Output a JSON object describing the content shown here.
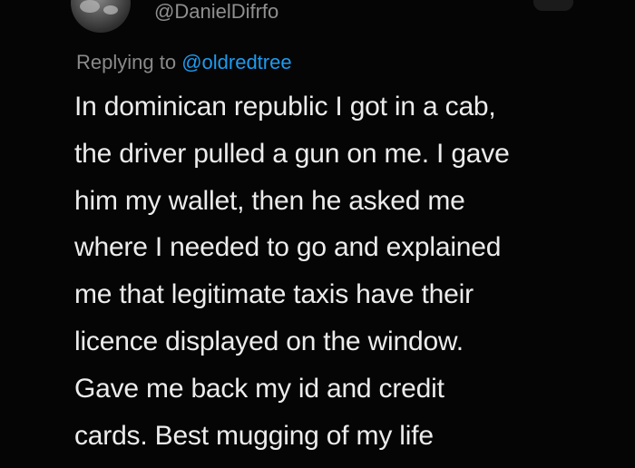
{
  "tweet": {
    "handle": "@DanielDifrfo",
    "replying_prefix": "Replying to ",
    "replying_mention": "@oldredtree",
    "lines": [
      "In dominican republic I got in a cab,",
      "the driver pulled a gun on me. I gave",
      "him my wallet, then he asked me",
      "where I needed to go and explained",
      "me that legitimate taxis have their",
      "licence displayed on the window.",
      "Gave me back my id and credit",
      "cards. Best mugging of my life"
    ]
  },
  "colors": {
    "background": "#050505",
    "text": "#ececec",
    "muted": "#8a8a8a",
    "mention": "#1d9bf0"
  }
}
